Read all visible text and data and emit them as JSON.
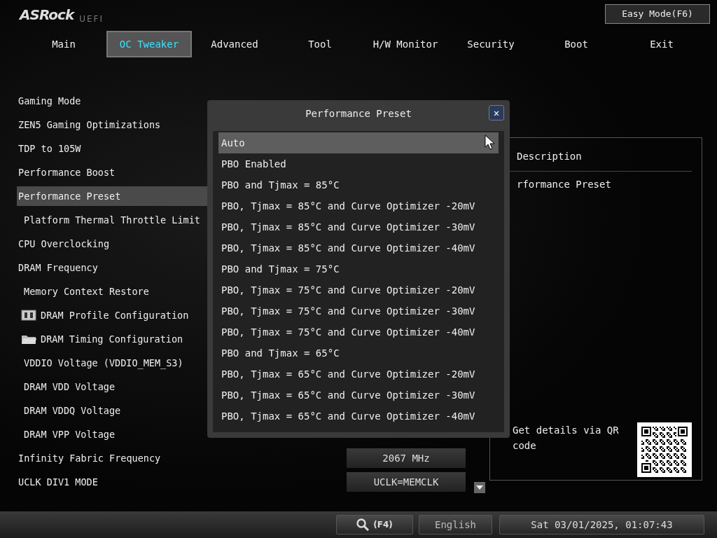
{
  "brand": {
    "logo": "ASRock",
    "sub": "UEFI"
  },
  "easy_mode_button": "Easy Mode(F6)",
  "tabs": [
    {
      "label": "Main",
      "selected": false
    },
    {
      "label": "OC Tweaker",
      "selected": true
    },
    {
      "label": "Advanced",
      "selected": false
    },
    {
      "label": "Tool",
      "selected": false
    },
    {
      "label": "H/W Monitor",
      "selected": false
    },
    {
      "label": "Security",
      "selected": false
    },
    {
      "label": "Boot",
      "selected": false
    },
    {
      "label": "Exit",
      "selected": false
    }
  ],
  "settings": [
    {
      "label": "Gaming Mode",
      "kind": "item",
      "selected": false
    },
    {
      "label": "ZEN5 Gaming Optimizations",
      "kind": "item",
      "selected": false
    },
    {
      "label": "TDP to 105W",
      "kind": "item",
      "selected": false
    },
    {
      "label": "Performance Boost",
      "kind": "item",
      "selected": false
    },
    {
      "label": "Performance Preset",
      "kind": "item",
      "selected": true
    },
    {
      "label": "Platform Thermal Throttle Limit",
      "kind": "subitem",
      "selected": false
    },
    {
      "label": "CPU Overclocking",
      "kind": "item",
      "selected": false
    },
    {
      "label": "DRAM Frequency",
      "kind": "item",
      "selected": false
    },
    {
      "label": "Memory Context Restore",
      "kind": "subitem",
      "selected": false
    },
    {
      "label": "DRAM Profile Configuration",
      "kind": "profile",
      "selected": false
    },
    {
      "label": "DRAM Timing Configuration",
      "kind": "folder",
      "selected": false
    },
    {
      "label": "VDDIO Voltage (VDDIO_MEM_S3)",
      "kind": "subitem",
      "selected": false
    },
    {
      "label": "DRAM VDD Voltage",
      "kind": "subitem",
      "selected": false
    },
    {
      "label": "DRAM VDDQ Voltage",
      "kind": "subitem",
      "selected": false
    },
    {
      "label": "DRAM VPP Voltage",
      "kind": "subitem",
      "selected": false
    },
    {
      "label": "Infinity Fabric Frequency",
      "kind": "item",
      "selected": false,
      "value": "2067 MHz"
    },
    {
      "label": "UCLK DIV1 MODE",
      "kind": "item",
      "selected": false,
      "value": "UCLK=MEMCLK"
    }
  ],
  "description": {
    "title": "Description",
    "text": "rformance Preset",
    "qr_caption": "Get details via QR code"
  },
  "modal": {
    "title": "Performance Preset",
    "close": "✕",
    "options": [
      {
        "label": "Auto",
        "selected": true
      },
      {
        "label": "PBO Enabled",
        "selected": false
      },
      {
        "label": "PBO and Tjmax = 85°C",
        "selected": false
      },
      {
        "label": "PBO, Tjmax = 85°C and Curve Optimizer -20mV",
        "selected": false
      },
      {
        "label": "PBO, Tjmax = 85°C and Curve Optimizer -30mV",
        "selected": false
      },
      {
        "label": "PBO, Tjmax = 85°C and Curve Optimizer -40mV",
        "selected": false
      },
      {
        "label": "PBO and Tjmax = 75°C",
        "selected": false
      },
      {
        "label": "PBO, Tjmax = 75°C and Curve Optimizer -20mV",
        "selected": false
      },
      {
        "label": "PBO, Tjmax = 75°C and Curve Optimizer -30mV",
        "selected": false
      },
      {
        "label": "PBO, Tjmax = 75°C and Curve Optimizer -40mV",
        "selected": false
      },
      {
        "label": "PBO and Tjmax = 65°C",
        "selected": false
      },
      {
        "label": "PBO, Tjmax = 65°C and Curve Optimizer -20mV",
        "selected": false
      },
      {
        "label": "PBO, Tjmax = 65°C and Curve Optimizer -30mV",
        "selected": false
      },
      {
        "label": "PBO, Tjmax = 65°C and Curve Optimizer -40mV",
        "selected": false
      }
    ]
  },
  "footer": {
    "search_key": "(F4)",
    "language": "English",
    "datetime": "Sat 03/01/2025, 01:07:43"
  }
}
